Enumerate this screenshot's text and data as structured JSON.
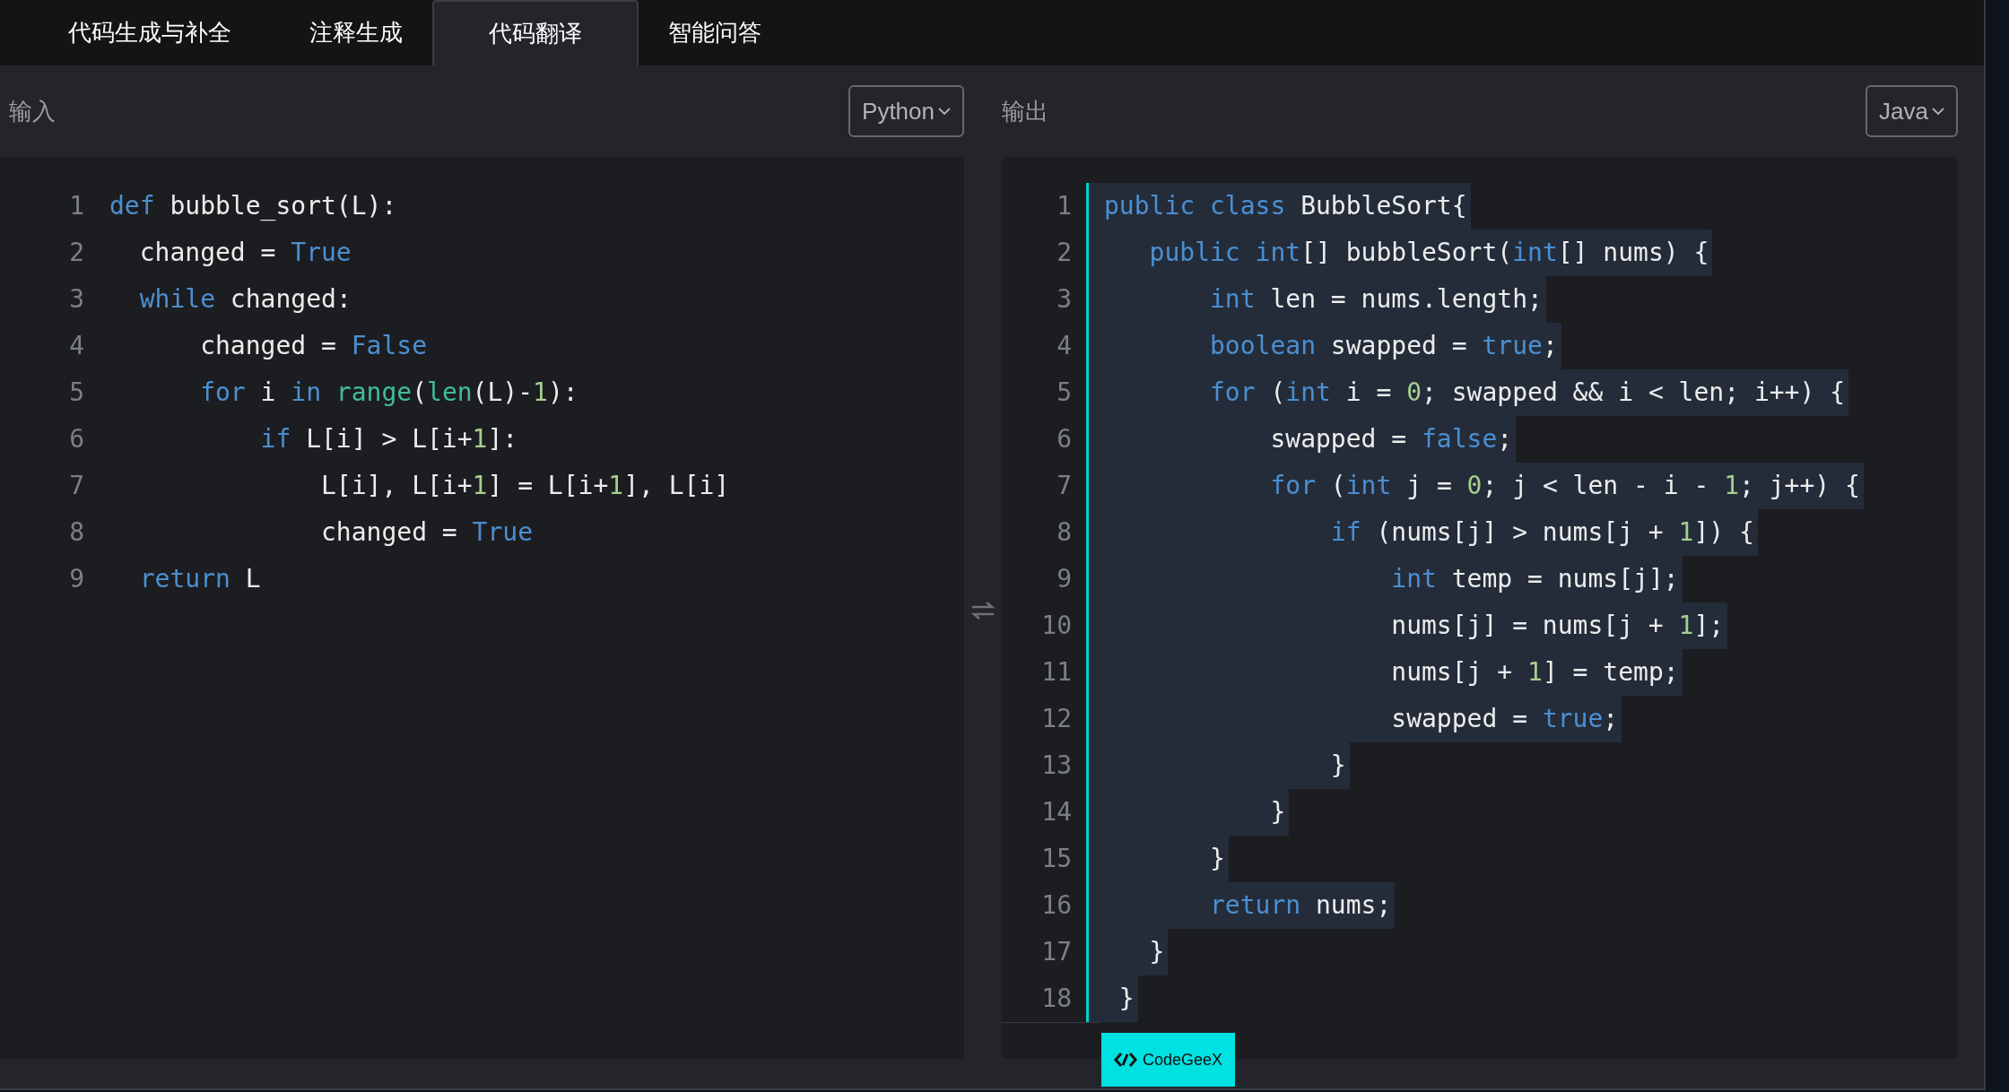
{
  "tabs": [
    {
      "label": "代码生成与补全",
      "selected": false
    },
    {
      "label": "注释生成",
      "selected": false
    },
    {
      "label": "代码翻译",
      "selected": true
    },
    {
      "label": "智能问答",
      "selected": false
    }
  ],
  "input": {
    "label": "输入",
    "language": "Python",
    "lines": [
      {
        "number": "1",
        "tokens": [
          {
            "kind": "keyword",
            "text": "def"
          },
          {
            "kind": "text",
            "text": " bubble_sort(L):"
          }
        ]
      },
      {
        "number": "2",
        "tokens": [
          {
            "kind": "text",
            "text": "  changed = "
          },
          {
            "kind": "keyword",
            "text": "True"
          }
        ]
      },
      {
        "number": "3",
        "tokens": [
          {
            "kind": "keyword",
            "text": "  while"
          },
          {
            "kind": "text",
            "text": " changed:"
          }
        ]
      },
      {
        "number": "4",
        "tokens": [
          {
            "kind": "text",
            "text": "      changed = "
          },
          {
            "kind": "keyword",
            "text": "False"
          }
        ]
      },
      {
        "number": "5",
        "tokens": [
          {
            "kind": "keyword",
            "text": "      for"
          },
          {
            "kind": "text",
            "text": " i "
          },
          {
            "kind": "keyword",
            "text": "in"
          },
          {
            "kind": "builtin",
            "text": " range"
          },
          {
            "kind": "text",
            "text": "("
          },
          {
            "kind": "builtin",
            "text": "len"
          },
          {
            "kind": "text",
            "text": "(L)-"
          },
          {
            "kind": "number",
            "text": "1"
          },
          {
            "kind": "text",
            "text": "):"
          }
        ]
      },
      {
        "number": "6",
        "tokens": [
          {
            "kind": "keyword",
            "text": "          if"
          },
          {
            "kind": "text",
            "text": " L[i] > L[i+"
          },
          {
            "kind": "number",
            "text": "1"
          },
          {
            "kind": "text",
            "text": "]:"
          }
        ]
      },
      {
        "number": "7",
        "tokens": [
          {
            "kind": "text",
            "text": "              L[i], L[i+"
          },
          {
            "kind": "number",
            "text": "1"
          },
          {
            "kind": "text",
            "text": "] = L[i+"
          },
          {
            "kind": "number",
            "text": "1"
          },
          {
            "kind": "text",
            "text": "], L[i]"
          }
        ]
      },
      {
        "number": "8",
        "tokens": [
          {
            "kind": "text",
            "text": "              changed = "
          },
          {
            "kind": "keyword",
            "text": "True"
          }
        ]
      },
      {
        "number": "9",
        "tokens": [
          {
            "kind": "keyword",
            "text": "  return"
          },
          {
            "kind": "text",
            "text": " L"
          }
        ]
      }
    ]
  },
  "output": {
    "label": "输出",
    "language": "Java",
    "lines": [
      {
        "number": "1",
        "selected": true,
        "tokens": [
          {
            "kind": "keyword",
            "text": "public class"
          },
          {
            "kind": "text",
            "text": " BubbleSort{"
          }
        ]
      },
      {
        "number": "2",
        "selected": true,
        "tokens": [
          {
            "kind": "keyword",
            "text": "   public int"
          },
          {
            "kind": "text",
            "text": "[] bubbleSort("
          },
          {
            "kind": "keyword",
            "text": "int"
          },
          {
            "kind": "text",
            "text": "[] nums) {"
          }
        ]
      },
      {
        "number": "3",
        "selected": true,
        "tokens": [
          {
            "kind": "keyword",
            "text": "       int"
          },
          {
            "kind": "text",
            "text": " len = nums.length;"
          }
        ]
      },
      {
        "number": "4",
        "selected": true,
        "tokens": [
          {
            "kind": "keyword",
            "text": "       boolean"
          },
          {
            "kind": "text",
            "text": " swapped = "
          },
          {
            "kind": "keyword",
            "text": "true"
          },
          {
            "kind": "text",
            "text": ";"
          }
        ]
      },
      {
        "number": "5",
        "selected": true,
        "tokens": [
          {
            "kind": "keyword",
            "text": "       for"
          },
          {
            "kind": "text",
            "text": " ("
          },
          {
            "kind": "keyword",
            "text": "int"
          },
          {
            "kind": "text",
            "text": " i = "
          },
          {
            "kind": "number",
            "text": "0"
          },
          {
            "kind": "text",
            "text": "; swapped && i < len; i++) {"
          }
        ]
      },
      {
        "number": "6",
        "selected": true,
        "tokens": [
          {
            "kind": "text",
            "text": "           swapped = "
          },
          {
            "kind": "keyword",
            "text": "false"
          },
          {
            "kind": "text",
            "text": ";"
          }
        ]
      },
      {
        "number": "7",
        "selected": true,
        "tokens": [
          {
            "kind": "keyword",
            "text": "           for"
          },
          {
            "kind": "text",
            "text": " ("
          },
          {
            "kind": "keyword",
            "text": "int"
          },
          {
            "kind": "text",
            "text": " j = "
          },
          {
            "kind": "number",
            "text": "0"
          },
          {
            "kind": "text",
            "text": "; j < len - i - "
          },
          {
            "kind": "number",
            "text": "1"
          },
          {
            "kind": "text",
            "text": "; j++) {"
          }
        ]
      },
      {
        "number": "8",
        "selected": true,
        "tokens": [
          {
            "kind": "keyword",
            "text": "               if"
          },
          {
            "kind": "text",
            "text": " (nums[j] > nums[j + "
          },
          {
            "kind": "number",
            "text": "1"
          },
          {
            "kind": "text",
            "text": "]) {"
          }
        ]
      },
      {
        "number": "9",
        "selected": true,
        "tokens": [
          {
            "kind": "keyword",
            "text": "                   int"
          },
          {
            "kind": "text",
            "text": " temp = nums[j];"
          }
        ]
      },
      {
        "number": "10",
        "selected": true,
        "tokens": [
          {
            "kind": "text",
            "text": "                   nums[j] = nums[j + "
          },
          {
            "kind": "number",
            "text": "1"
          },
          {
            "kind": "text",
            "text": "];"
          }
        ]
      },
      {
        "number": "11",
        "selected": true,
        "tokens": [
          {
            "kind": "text",
            "text": "                   nums[j + "
          },
          {
            "kind": "number",
            "text": "1"
          },
          {
            "kind": "text",
            "text": "] = temp;"
          }
        ]
      },
      {
        "number": "12",
        "selected": true,
        "tokens": [
          {
            "kind": "text",
            "text": "                   swapped = "
          },
          {
            "kind": "keyword",
            "text": "true"
          },
          {
            "kind": "text",
            "text": ";"
          }
        ]
      },
      {
        "number": "13",
        "selected": true,
        "tokens": [
          {
            "kind": "text",
            "text": "               }"
          }
        ]
      },
      {
        "number": "14",
        "selected": true,
        "tokens": [
          {
            "kind": "text",
            "text": "           }"
          }
        ]
      },
      {
        "number": "15",
        "selected": true,
        "tokens": [
          {
            "kind": "text",
            "text": "       }"
          }
        ]
      },
      {
        "number": "16",
        "selected": true,
        "tokens": [
          {
            "kind": "keyword",
            "text": "       return"
          },
          {
            "kind": "text",
            "text": " nums;"
          }
        ]
      },
      {
        "number": "17",
        "selected": true,
        "tokens": [
          {
            "kind": "text",
            "text": "   }"
          }
        ]
      },
      {
        "number": "18",
        "selected": true,
        "tokens": [
          {
            "kind": "text",
            "text": " }"
          }
        ]
      }
    ]
  },
  "badge": {
    "label": "CodeGeeX"
  }
}
